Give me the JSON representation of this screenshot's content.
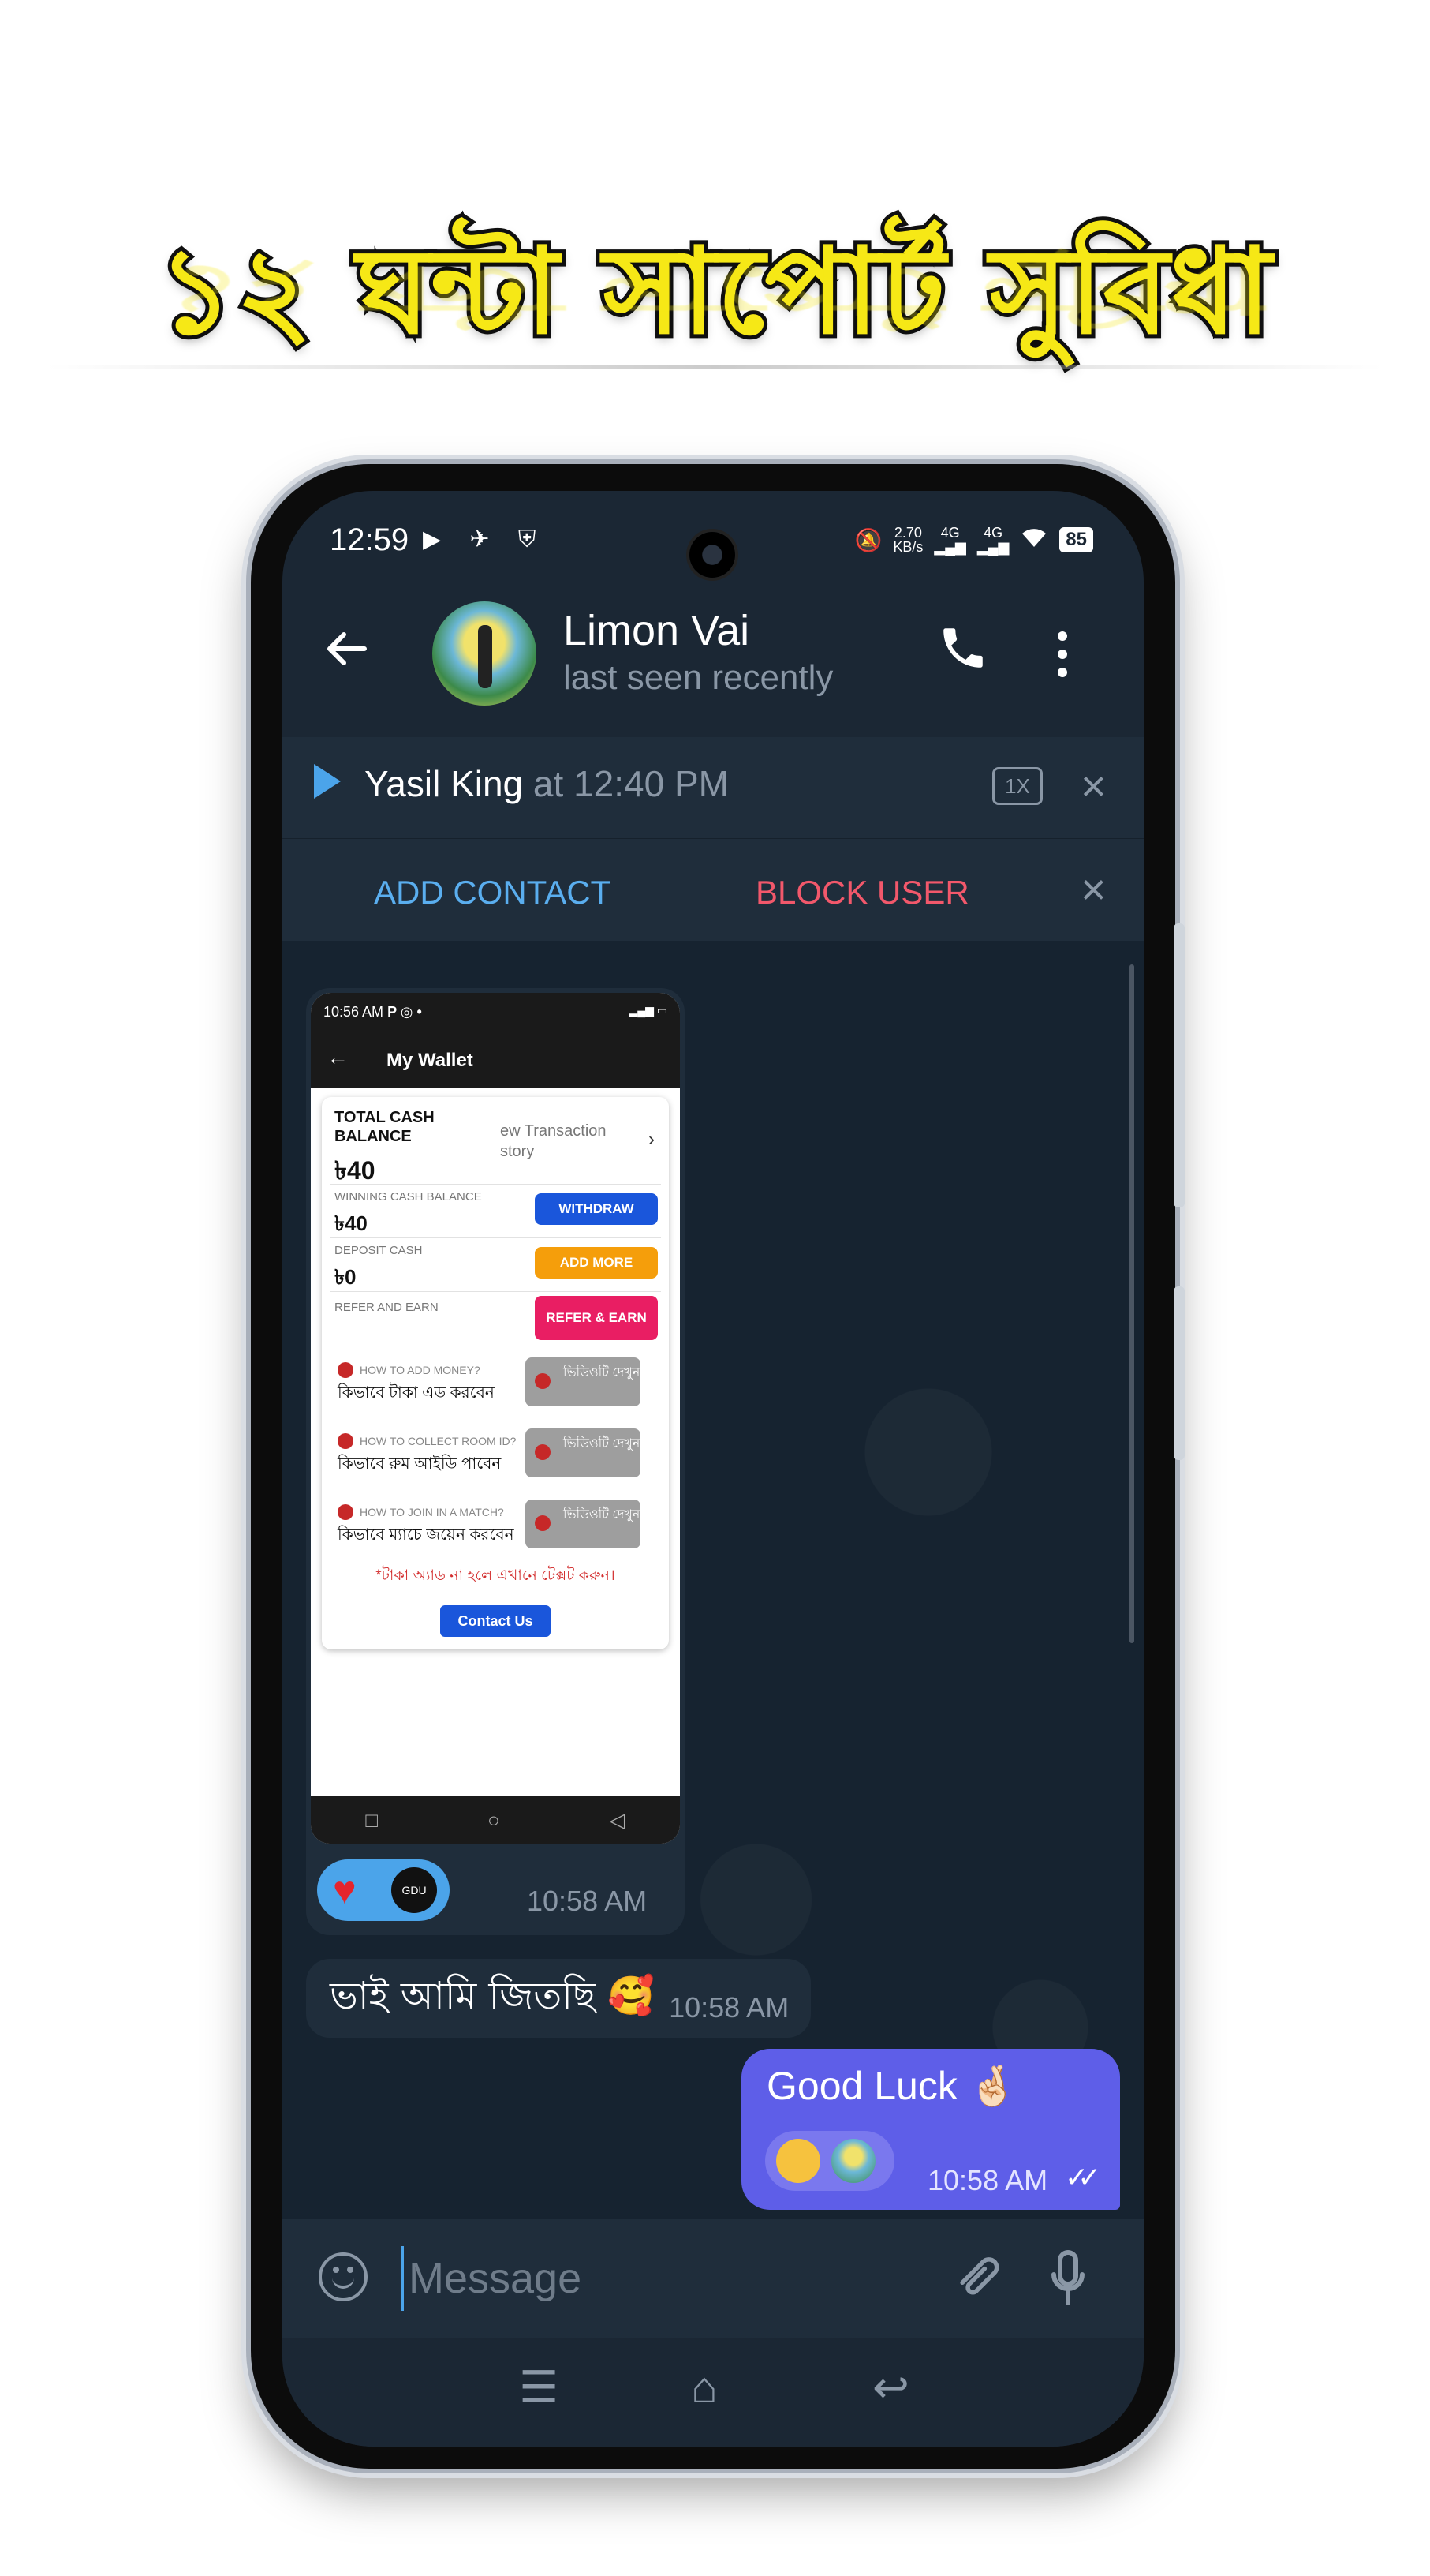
{
  "banner": {
    "headline": "১২ ঘন্টা সাপোর্ট সুবিধা"
  },
  "status_bar": {
    "time": "12:59",
    "left_icons": "▶ ✈ ⛨",
    "speed": "2.70",
    "speed_unit": "KB/s",
    "net1": "4G",
    "net2": "4G",
    "battery": "85"
  },
  "header": {
    "contact_name": "Limon Vai",
    "contact_status": "last seen recently"
  },
  "audio_player": {
    "user": "Yasil King",
    "time": "at 12:40 PM",
    "speed": "1X"
  },
  "actions": {
    "add_contact": "ADD CONTACT",
    "block_user": "BLOCK USER"
  },
  "shared_screenshot": {
    "status_time": "10:56 AM",
    "status_icons": "P ◎ •",
    "title": "My Wallet",
    "total_label": "TOTAL CASH BALANCE",
    "total_amount": "৳40",
    "view_transactions": "ew Transaction story",
    "winning_label": "WINNING CASH BALANCE",
    "winning_amount": "৳40",
    "withdraw": "WITHDRAW",
    "deposit_label": "DEPOSIT CASH",
    "deposit_amount": "৳0",
    "add_more": "ADD MORE",
    "refer_label": "REFER AND EARN",
    "refer_btn": "REFER & EARN",
    "help": [
      {
        "q": "HOW TO ADD MONEY?",
        "a": "কিভাবে টাকা এড করবেন",
        "btn": "ভিডিওটি দেখুন"
      },
      {
        "q": "HOW TO COLLECT ROOM ID?",
        "a": "কিভাবে রুম আইডি পাবেন",
        "btn": "ভিডিওটি দেখুন"
      },
      {
        "q": "HOW TO JOIN IN A MATCH?",
        "a": "কিভাবে ম্যাচে জয়েন করবেন",
        "btn": "ভিডিওটি দেখুন"
      }
    ],
    "note": "*টাকা অ্যাড না হলে এখানে টেক্সট করুন।",
    "contact_us": "Contact Us",
    "react_avatar": "GDU"
  },
  "messages": [
    {
      "type": "media",
      "time": "10:58 AM"
    },
    {
      "type": "incoming",
      "text": "ভাই আমি জিতছি 🥰",
      "time": "10:58 AM"
    },
    {
      "type": "outgoing",
      "text": "Good Luck 🤞🏻",
      "time": "10:58 AM",
      "status": "read"
    }
  ],
  "input": {
    "placeholder": "Message"
  },
  "icons": {
    "back": "back-arrow-icon",
    "call": "phone-icon",
    "menu": "more-vertical-icon",
    "emoji": "emoji-icon",
    "attach": "paperclip-icon",
    "mic": "microphone-icon"
  },
  "colors": {
    "accent": "#4ba4ea",
    "outgoing_bubble": "#5e5ee8",
    "block": "#f2586b",
    "headline": "#f6e816"
  }
}
